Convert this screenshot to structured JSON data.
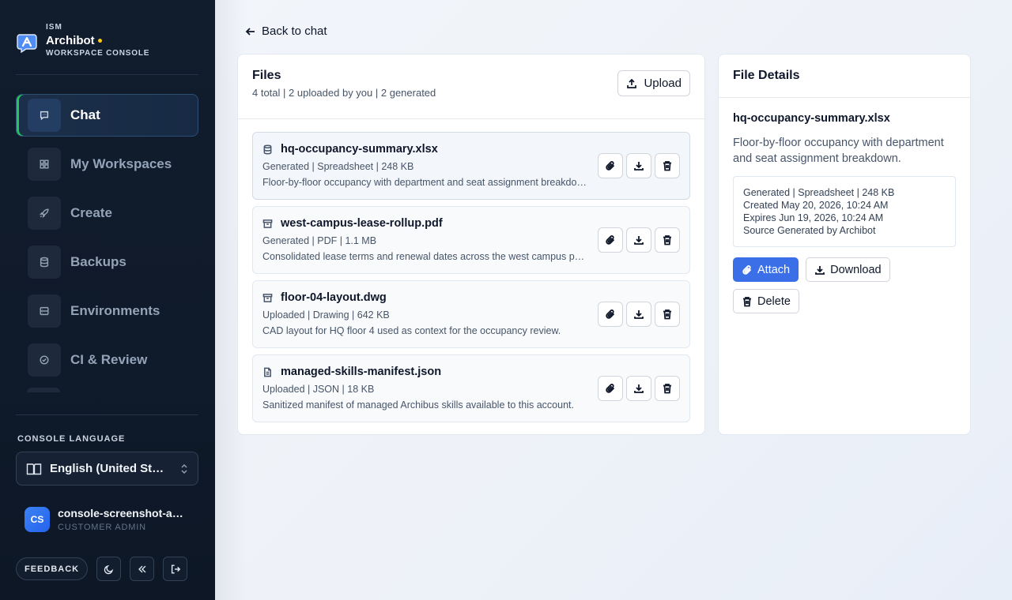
{
  "brand": {
    "org": "ISM",
    "name": "Archibot",
    "subtitle": "WORKSPACE CONSOLE",
    "accent_dot_color": "#facc15"
  },
  "nav": {
    "items": [
      {
        "label": "Chat",
        "icon": "chat-bubble-icon",
        "active": true
      },
      {
        "label": "My Workspaces",
        "icon": "grid-icon",
        "active": false
      },
      {
        "label": "Create",
        "icon": "rocket-icon",
        "active": false
      },
      {
        "label": "Backups",
        "icon": "database-icon",
        "active": false
      },
      {
        "label": "Environments",
        "icon": "server-icon",
        "active": false
      },
      {
        "label": "CI & Review",
        "icon": "check-circle-icon",
        "active": false
      }
    ],
    "active_indicator_color": "#22c55e"
  },
  "language": {
    "title": "CONSOLE LANGUAGE",
    "value": "English (United States)",
    "icon": "book-icon"
  },
  "user": {
    "initials": "CS",
    "name": "console-screenshot-admin",
    "role": "CUSTOMER ADMIN"
  },
  "footer": {
    "feedback_label": "FEEDBACK",
    "buttons": [
      "moon-icon",
      "collapse-icon",
      "logout-icon"
    ]
  },
  "main": {
    "back_label": "Back to chat"
  },
  "files": {
    "title": "Files",
    "summary": "4 total | 2 uploaded by you | 2 generated",
    "upload_label": "Upload",
    "items": [
      {
        "name": "hq-occupancy-summary.xlsx",
        "icon": "database-icon",
        "meta": "Generated | Spreadsheet | 248 KB",
        "description": "Floor-by-floor occupancy with department and seat assignment breakdown.",
        "selected": true
      },
      {
        "name": "west-campus-lease-rollup.pdf",
        "icon": "archive-icon",
        "meta": "Generated | PDF | 1.1 MB",
        "description": "Consolidated lease terms and renewal dates across the west campus portfolio.",
        "selected": false
      },
      {
        "name": "floor-04-layout.dwg",
        "icon": "archive-icon",
        "meta": "Uploaded | Drawing | 642 KB",
        "description": "CAD layout for HQ floor 4 used as context for the occupancy review.",
        "selected": false
      },
      {
        "name": "managed-skills-manifest.json",
        "icon": "document-icon",
        "meta": "Uploaded | JSON | 18 KB",
        "description": "Sanitized manifest of managed Archibus skills available to this account.",
        "selected": false
      }
    ]
  },
  "details": {
    "title": "File Details",
    "name": "hq-occupancy-summary.xlsx",
    "description": "Floor-by-floor occupancy with department and seat assignment breakdown.",
    "meta": "Generated | Spreadsheet | 248 KB",
    "created": "Created May 20, 2026, 10:24 AM",
    "expires": "Expires Jun 19, 2026, 10:24 AM",
    "source": "Source Generated by Archibot",
    "attach_label": "Attach",
    "download_label": "Download",
    "delete_label": "Delete",
    "primary_color": "#3b6fe8"
  }
}
